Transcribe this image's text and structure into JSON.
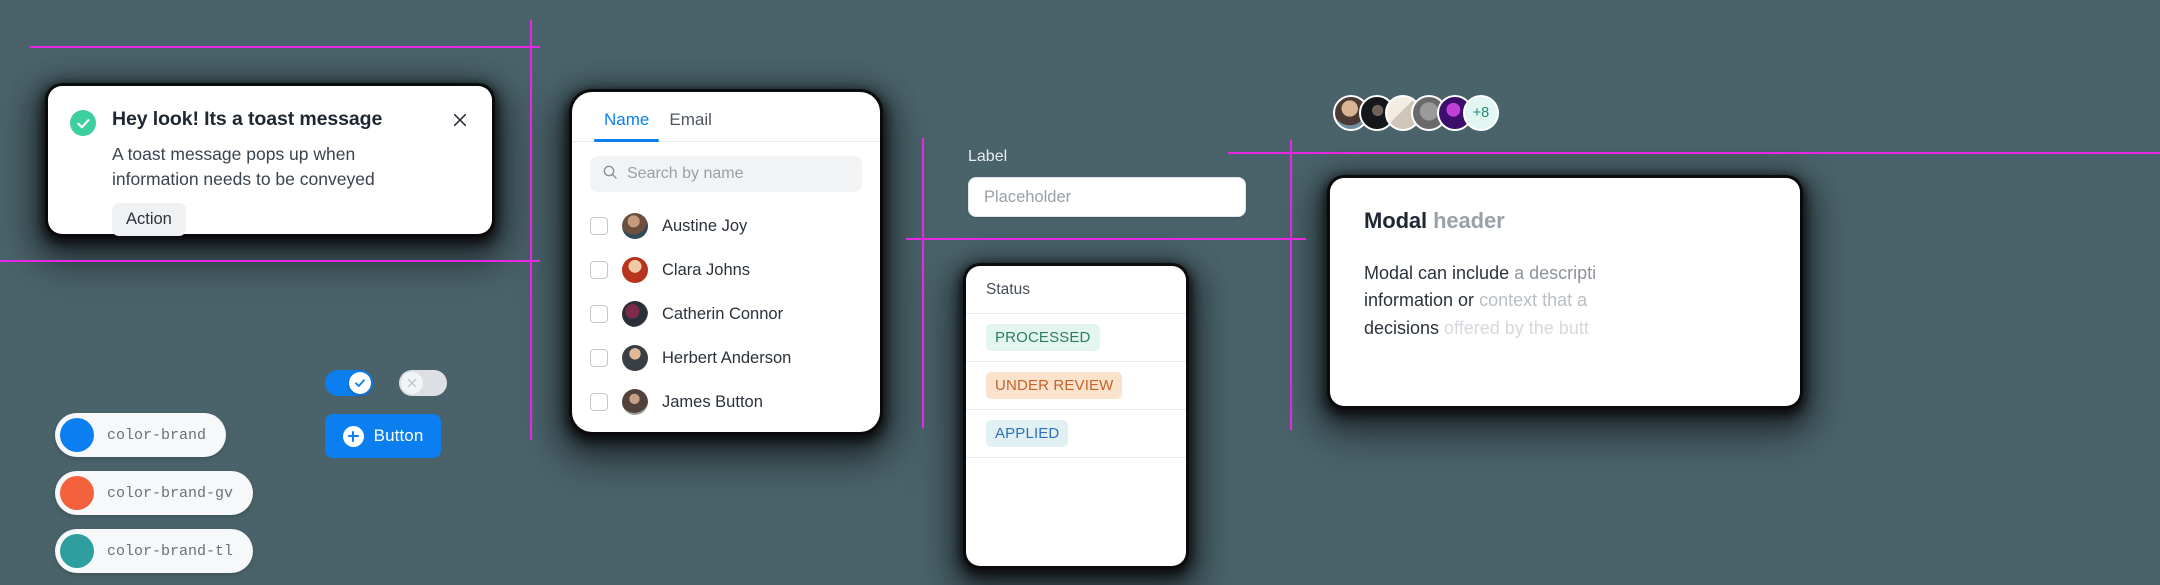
{
  "page": {
    "background_color": "#4a636a",
    "guide_color": "#e628e6"
  },
  "toast": {
    "title": "Hey look! Its a toast message",
    "description": "A toast message pops up when information needs to be conveyed",
    "action_label": "Action",
    "close_icon": "close-icon",
    "status_icon": "check-circle-icon",
    "status_color": "#3ecfa0"
  },
  "swatches": [
    {
      "label": "color-brand",
      "color": "#0b7ff0"
    },
    {
      "label": "color-brand-gv",
      "color": "#f2603c"
    },
    {
      "label": "color-brand-tl",
      "color": "#2e9e9e"
    }
  ],
  "primary_button": {
    "label": "Button",
    "icon": "plus-circle-icon",
    "color": "#0b7ff0"
  },
  "toggles": [
    {
      "name": "toggle-on",
      "state": "on",
      "icon": "check-icon",
      "color": "#0b7ff0"
    },
    {
      "name": "toggle-off",
      "state": "off",
      "icon": "close-icon",
      "color": "#dcdfe3"
    }
  ],
  "phone_panel": {
    "tabs": [
      {
        "label": "Name",
        "active": true
      },
      {
        "label": "Email",
        "active": false
      }
    ],
    "search": {
      "placeholder": "Search by name",
      "value": "",
      "icon": "search-icon"
    },
    "people": [
      {
        "name": "Austine Joy",
        "checked": false,
        "avatar": "#8a6f5f"
      },
      {
        "name": "Clara Johns",
        "checked": false,
        "avatar": "#d4512a"
      },
      {
        "name": "Catherin Connor",
        "checked": false,
        "avatar": "#4a4a52"
      },
      {
        "name": "Herbert Anderson",
        "checked": false,
        "avatar": "#6d6f72"
      },
      {
        "name": "James Button",
        "checked": false,
        "avatar": "#9a7a63"
      }
    ]
  },
  "field": {
    "label": "Label",
    "placeholder": "Placeholder",
    "value": ""
  },
  "status_table": {
    "header": "Status",
    "rows": [
      {
        "label": "PROCESSED",
        "text_color": "#2e7d63",
        "bg_color": "#e3f5ef"
      },
      {
        "label": "UNDER REVIEW",
        "text_color": "#c3642a",
        "bg_color": "#fbe2cd"
      },
      {
        "label": "APPLIED",
        "text_color": "#2f6fb5",
        "bg_color": "#e1f1f3"
      }
    ]
  },
  "avatar_stack": {
    "overflow_label": "+8",
    "overflow_text_color": "#23897a",
    "overflow_bg_color": "#e2f6f2",
    "avatars": [
      "#7a6a5e",
      "#2e2e30",
      "#d8d3cb",
      "#8d8d8d",
      "#5b1f8c"
    ]
  },
  "modal": {
    "header_strong": "Modal",
    "header_dim": "header",
    "body_part1": "Modal can include ",
    "body_part2": "a descripti",
    "body_line2_part1": "information or ",
    "body_line2_part2": "context that a",
    "body_line3_part1": "decisions ",
    "body_line3_part2": "offered by the butt"
  }
}
